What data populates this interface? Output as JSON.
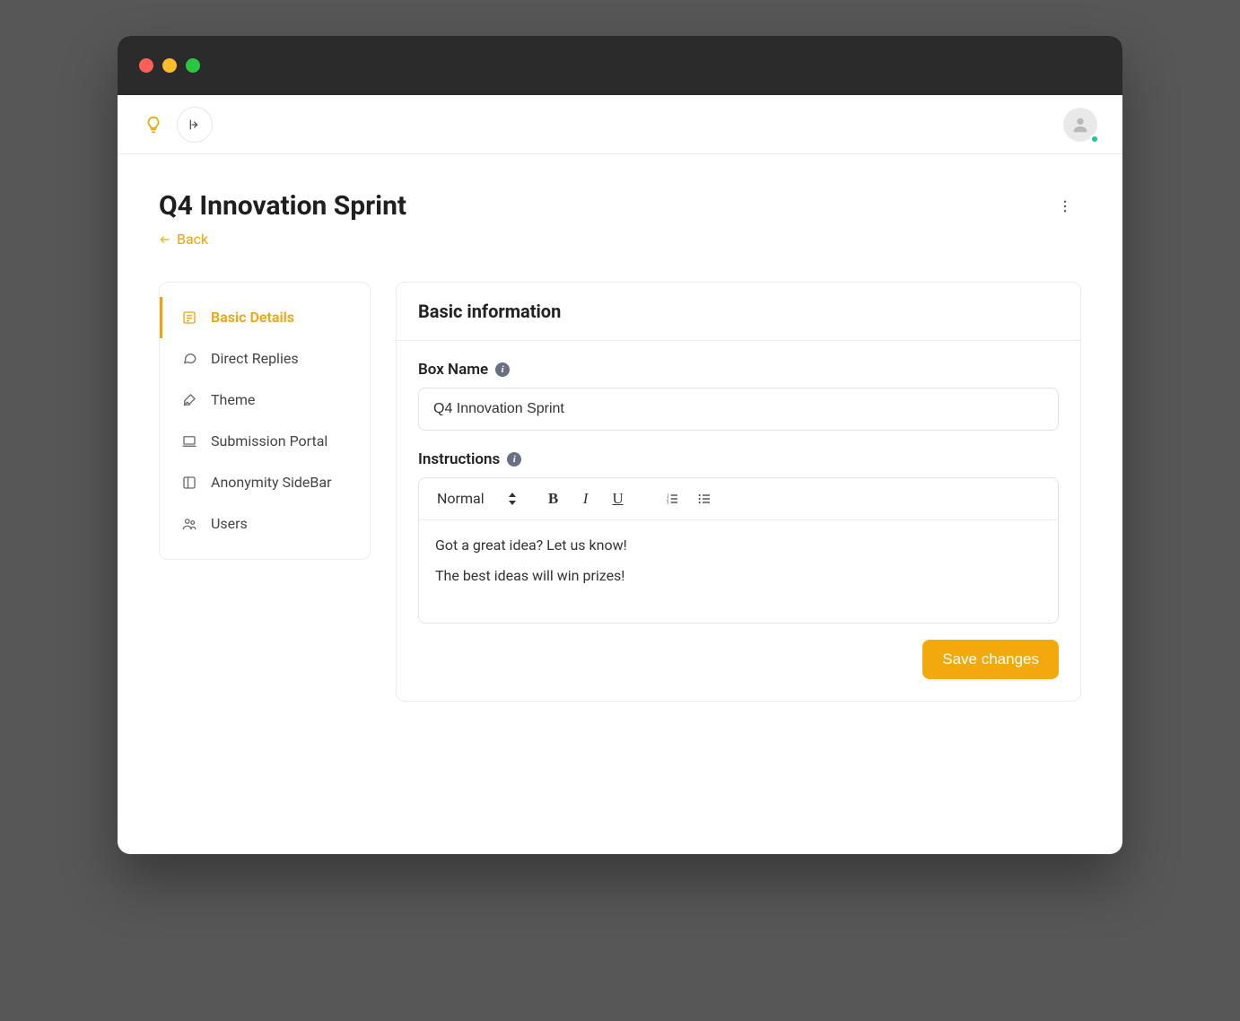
{
  "page": {
    "title": "Q4 Innovation Sprint",
    "back_label": "Back"
  },
  "sidebar": {
    "items": [
      {
        "label": "Basic Details"
      },
      {
        "label": "Direct Replies"
      },
      {
        "label": "Theme"
      },
      {
        "label": "Submission Portal"
      },
      {
        "label": "Anonymity SideBar"
      },
      {
        "label": "Users"
      }
    ]
  },
  "panel": {
    "header": "Basic information",
    "box_name_label": "Box Name",
    "box_name_value": "Q4 Innovation Sprint",
    "instructions_label": "Instructions",
    "format_selected": "Normal",
    "instructions_line1": "Got a great idea? Let us know!",
    "instructions_line2": "The best ideas will win prizes!",
    "save_label": "Save changes"
  },
  "colors": {
    "accent": "#f2a90d"
  }
}
